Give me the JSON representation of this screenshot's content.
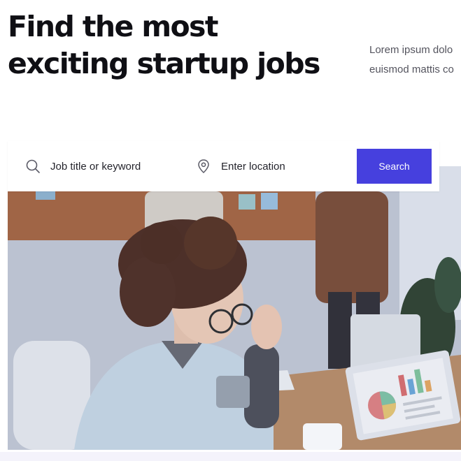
{
  "hero": {
    "title_line1": "Find the most",
    "title_line2": "exciting startup jobs",
    "description_line1": "Lorem ipsum dolo",
    "description_line2": "euismod mattis co"
  },
  "search": {
    "keyword_placeholder": "Job title or keyword",
    "location_placeholder": "Enter location",
    "button_label": "Search",
    "keyword_icon": "search-icon",
    "location_icon": "map-pin-icon"
  },
  "colors": {
    "accent": "#4640de",
    "title": "#0f0f14",
    "body_text": "#54545e",
    "bottom_band": "#f4f3fb"
  }
}
